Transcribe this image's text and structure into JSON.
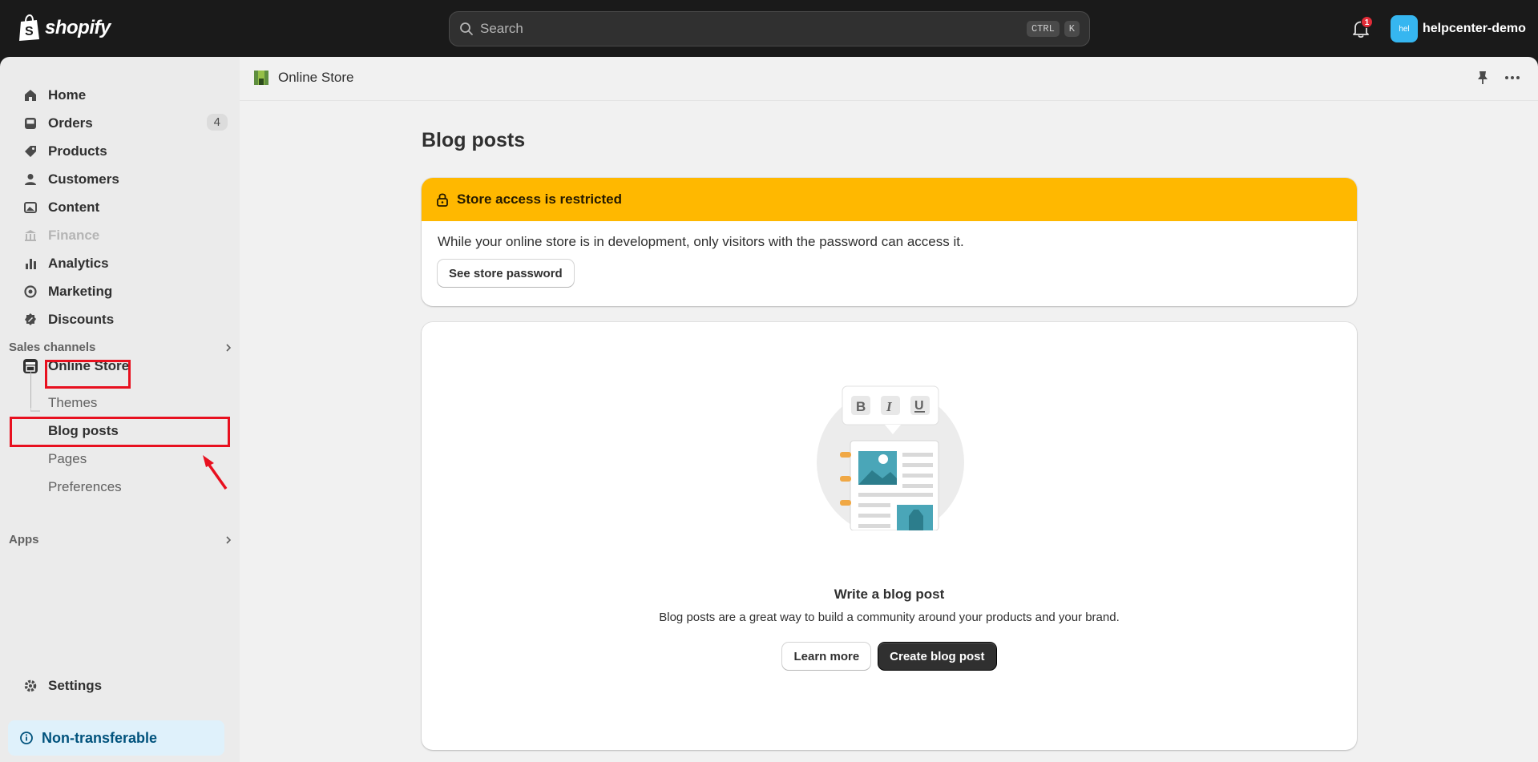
{
  "brand": {
    "name": "shopify"
  },
  "search": {
    "placeholder": "Search",
    "shortcut_1": "CTRL",
    "shortcut_2": "K"
  },
  "notifications": {
    "count": "1"
  },
  "account": {
    "avatar_text": "hel",
    "name": "helpcenter-demo"
  },
  "sidebar": {
    "items": [
      {
        "label": "Home",
        "icon": "home-icon"
      },
      {
        "label": "Orders",
        "icon": "orders-icon",
        "count": "4"
      },
      {
        "label": "Products",
        "icon": "tag-icon"
      },
      {
        "label": "Customers",
        "icon": "person-icon"
      },
      {
        "label": "Content",
        "icon": "image-icon"
      },
      {
        "label": "Finance",
        "icon": "bank-icon",
        "disabled": true
      },
      {
        "label": "Analytics",
        "icon": "bar-chart-icon"
      },
      {
        "label": "Marketing",
        "icon": "target-icon"
      },
      {
        "label": "Discounts",
        "icon": "discount-icon"
      }
    ],
    "sales_channels_label": "Sales channels",
    "online_store": {
      "label": "Online Store",
      "sub_items": [
        "Themes",
        "Blog posts",
        "Pages",
        "Preferences"
      ],
      "active": "Blog posts"
    },
    "apps_label": "Apps",
    "settings_label": "Settings",
    "notice": "Non-transferable"
  },
  "main": {
    "breadcrumb": "Online Store",
    "page_title": "Blog posts",
    "alert": {
      "title": "Store access is restricted",
      "message": "While your online store is in development, only visitors with the password can access it.",
      "button": "See store password"
    },
    "empty_state": {
      "title": "Write a blog post",
      "description": "Blog posts are a great way to build a community around your products and your brand.",
      "secondary_button": "Learn more",
      "primary_button": "Create blog post"
    }
  },
  "colors": {
    "alert_bg": "#ffb800",
    "highlight_box": "#e8101f",
    "notice_bg": "#dff1fb"
  }
}
